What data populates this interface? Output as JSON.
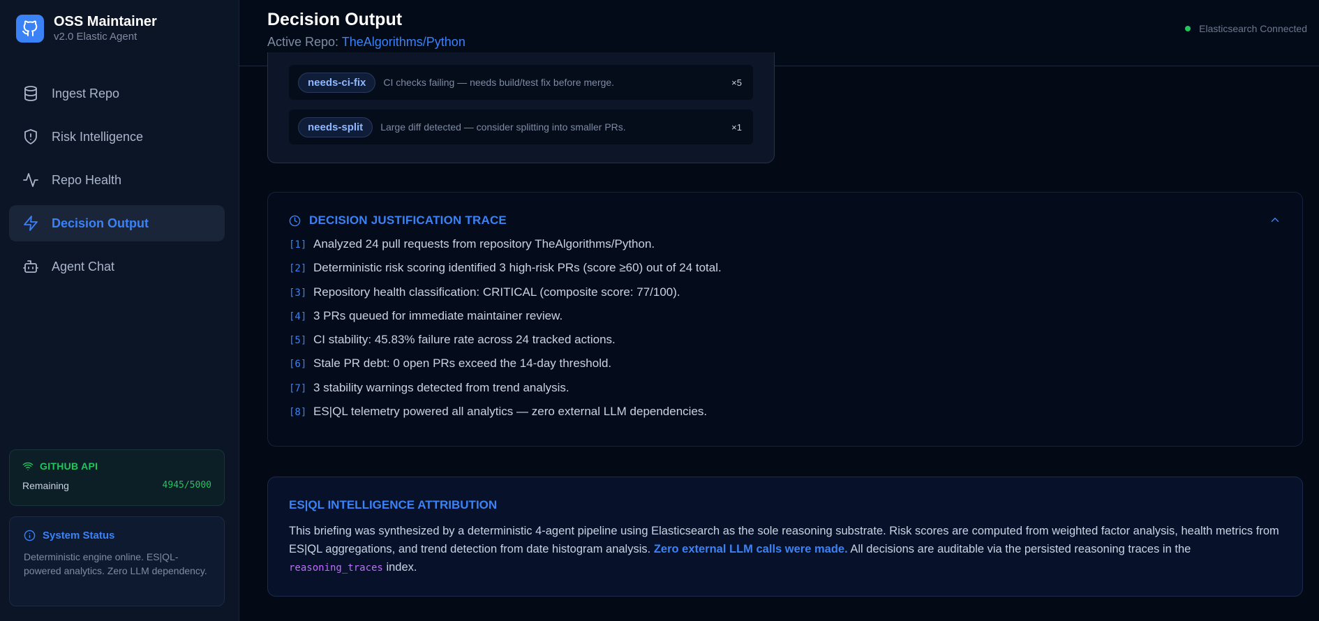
{
  "brand": {
    "title": "OSS Maintainer",
    "subtitle": "v2.0 Elastic Agent"
  },
  "sidebar": {
    "items": [
      {
        "label": "Ingest Repo",
        "icon": "database-icon",
        "active": false
      },
      {
        "label": "Risk Intelligence",
        "icon": "shield-alert-icon",
        "active": false
      },
      {
        "label": "Repo Health",
        "icon": "activity-icon",
        "active": false
      },
      {
        "label": "Decision Output",
        "icon": "lightning-icon",
        "active": true
      },
      {
        "label": "Agent Chat",
        "icon": "bot-icon",
        "active": false
      }
    ],
    "github_api": {
      "title": "GITHUB API",
      "remaining_label": "Remaining",
      "remaining_value": "4945/5000"
    },
    "system_status": {
      "title": "System Status",
      "body": "Deterministic engine online. ES|QL-powered analytics. Zero LLM dependency."
    }
  },
  "header": {
    "title": "Decision Output",
    "active_repo_label": "Active Repo:",
    "active_repo": "TheAlgorithms/Python",
    "connection_status": "Elasticsearch Connected"
  },
  "labels": [
    {
      "name": "needs-ci-fix",
      "description": "CI checks failing — needs build/test fix before merge.",
      "count": "×5"
    },
    {
      "name": "needs-split",
      "description": "Large diff detected — consider splitting into smaller PRs.",
      "count": "×1"
    }
  ],
  "trace": {
    "title": "DECISION JUSTIFICATION TRACE",
    "items": [
      {
        "num": "[1]",
        "text": "Analyzed 24 pull requests from repository TheAlgorithms/Python."
      },
      {
        "num": "[2]",
        "text": "Deterministic risk scoring identified 3 high-risk PRs (score ≥60) out of 24 total."
      },
      {
        "num": "[3]",
        "text": "Repository health classification: CRITICAL (composite score: 77/100)."
      },
      {
        "num": "[4]",
        "text": "3 PRs queued for immediate maintainer review."
      },
      {
        "num": "[5]",
        "text": "CI stability: 45.83% failure rate across 24 tracked actions."
      },
      {
        "num": "[6]",
        "text": "Stale PR debt: 0 open PRs exceed the 14-day threshold."
      },
      {
        "num": "[7]",
        "text": "3 stability warnings detected from trend analysis."
      },
      {
        "num": "[8]",
        "text": "ES|QL telemetry powered all analytics — zero external LLM dependencies."
      }
    ]
  },
  "attribution": {
    "title": "ES|QL INTELLIGENCE ATTRIBUTION",
    "body_part1": "This briefing was synthesized by a deterministic 4-agent pipeline using Elasticsearch as the sole reasoning substrate. Risk scores are computed from weighted factor analysis, health metrics from ES|QL aggregations, and trend detection from date histogram analysis. ",
    "highlight": "Zero external LLM calls were made.",
    "body_part2": " All decisions are auditable via the persisted reasoning traces in the ",
    "code": "reasoning_traces",
    "body_part3": " index."
  },
  "colors": {
    "accent": "#3b82f6",
    "success": "#22c55e",
    "background": "#030915",
    "sidebar": "#0c1526",
    "code": "#c06bff"
  }
}
